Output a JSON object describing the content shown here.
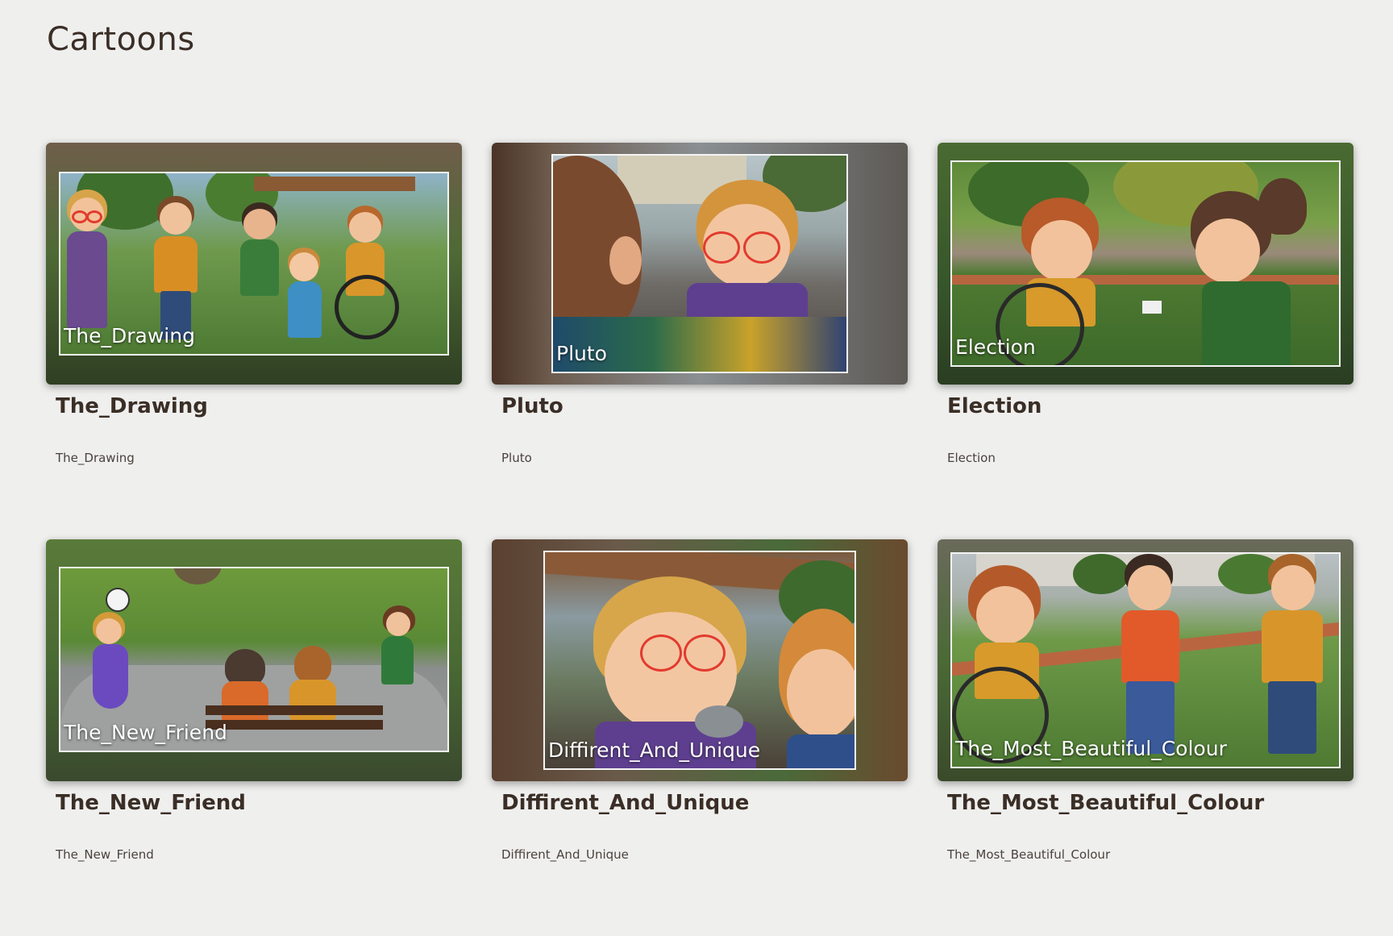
{
  "page": {
    "title": "Cartoons"
  },
  "cards": [
    {
      "overlay": "The_Drawing",
      "title": "The_Drawing",
      "subtitle": "The_Drawing"
    },
    {
      "overlay": "Pluto",
      "title": "Pluto",
      "subtitle": "Pluto"
    },
    {
      "overlay": "Election",
      "title": "Election",
      "subtitle": "Election"
    },
    {
      "overlay": "The_New_Friend",
      "title": "The_New_Friend",
      "subtitle": "The_New_Friend"
    },
    {
      "overlay": "Diffirent_And_Unique",
      "title": "Diffirent_And_Unique",
      "subtitle": "Diffirent_And_Unique"
    },
    {
      "overlay": "The_Most_Beautiful_Colour",
      "title": "The_Most_Beautiful_Colour",
      "subtitle": "The_Most_Beautiful_Colour"
    }
  ],
  "colors": {
    "background": "#efefee",
    "title_text": "#3a2e26",
    "grass": "#3f6b2a",
    "sky": "#9bb7c9"
  }
}
